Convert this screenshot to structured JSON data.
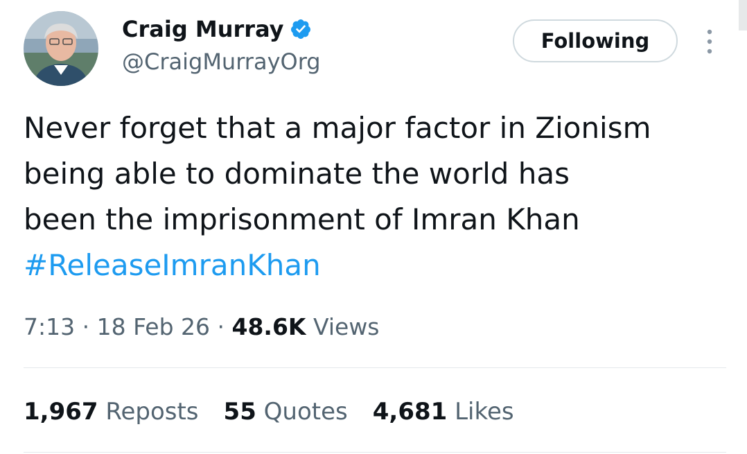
{
  "author": {
    "display_name": "Craig Murray",
    "handle": "@CraigMurrayOrg",
    "verified_icon": "verified-badge-icon",
    "avatar_icon": "avatar"
  },
  "follow_button": {
    "label": "Following"
  },
  "more_button": {
    "icon": "more-vertical-icon"
  },
  "tweet": {
    "lines": [
      "Never forget that a major factor in Zionism",
      "being able to dominate the world has",
      "been the imprisonment of Imran Khan"
    ],
    "hashtag": "#ReleaseImranKhan"
  },
  "meta": {
    "time": "7:13",
    "separator": "·",
    "date": "18 Feb 26",
    "views_count": "48.6K",
    "views_label": "Views"
  },
  "stats": {
    "reposts_count": "1,967",
    "reposts_label": "Reposts",
    "quotes_count": "55",
    "quotes_label": "Quotes",
    "likes_count": "4,681",
    "likes_label": "Likes"
  },
  "colors": {
    "link": "#1d9bf0",
    "secondary_text": "#536471",
    "primary_text": "#0f1419",
    "border": "#cfd9de"
  }
}
